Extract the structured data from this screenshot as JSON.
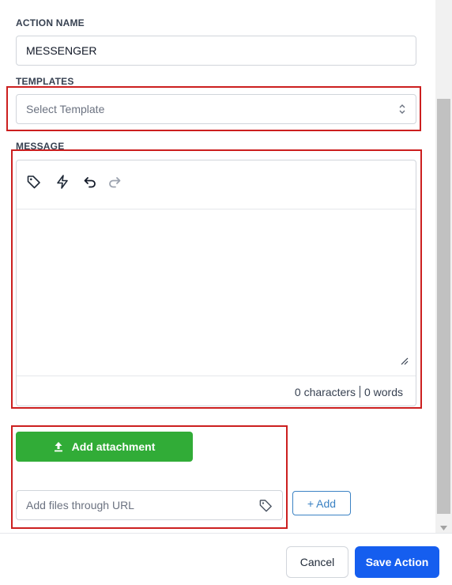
{
  "action_name": {
    "label": "ACTION NAME",
    "value": "MESSENGER"
  },
  "templates": {
    "label": "TEMPLATES",
    "placeholder": "Select Template"
  },
  "message": {
    "label": "MESSAGE",
    "toolbar_icons": [
      "tag-icon",
      "bolt-icon",
      "undo-icon",
      "redo-icon"
    ],
    "characters": "0 characters",
    "words": "0 words"
  },
  "attachment": {
    "button_label": "Add attachment",
    "url_placeholder": "Add files through URL",
    "add_label": "+ Add"
  },
  "footer": {
    "cancel_label": "Cancel",
    "save_label": "Save Action"
  },
  "colors": {
    "highlight": "#cc1f1f",
    "attachment_button": "#31ac37",
    "primary": "#155eef",
    "link": "#3b82c4"
  }
}
